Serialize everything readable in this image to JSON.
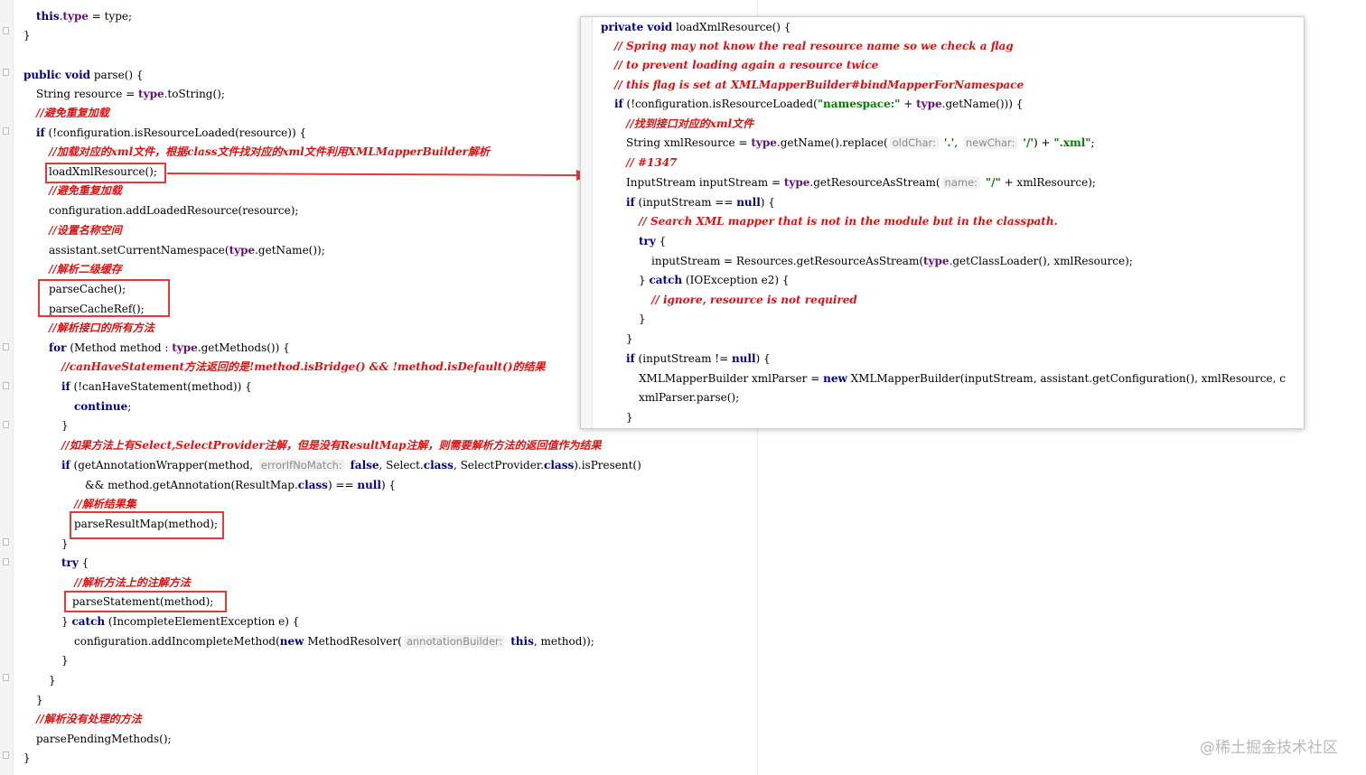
{
  "editor": {
    "lines": [
      [
        {
          "t": "this",
          "c": "kw"
        },
        {
          "t": "."
        },
        {
          "t": "type",
          "c": "fld"
        },
        {
          "t": " = type;"
        }
      ],
      [
        {
          "t": "}"
        }
      ],
      [
        {
          "t": "public void",
          "c": "kw"
        },
        {
          "t": " parse() {"
        }
      ],
      [
        {
          "t": "String resource = "
        },
        {
          "t": "type",
          "c": "fld"
        },
        {
          "t": ".toString();"
        }
      ],
      [
        {
          "t": "//避免重复加载",
          "c": "cm"
        }
      ],
      [
        {
          "t": "if",
          "c": "kw"
        },
        {
          "t": " (!configuration.isResourceLoaded(resource)) {"
        }
      ],
      [
        {
          "t": "//加载对应的xml文件，根据class文件找对应的xml文件利用XMLMapperBuilder解析",
          "c": "cm"
        }
      ],
      [
        {
          "t": "loadXmlResource();"
        }
      ],
      [
        {
          "t": "//避免重复加载",
          "c": "cm"
        }
      ],
      [
        {
          "t": "configuration.addLoadedResource(resource);"
        }
      ],
      [
        {
          "t": "//设置名称空间",
          "c": "cm"
        }
      ],
      [
        {
          "t": "assistant.setCurrentNamespace("
        },
        {
          "t": "type",
          "c": "fld"
        },
        {
          "t": ".getName());"
        }
      ],
      [
        {
          "t": "//解析二级缓存",
          "c": "cm"
        }
      ],
      [
        {
          "t": "parseCache();"
        }
      ],
      [
        {
          "t": "parseCacheRef();"
        }
      ],
      [
        {
          "t": "//解析接口的所有方法",
          "c": "cm"
        }
      ],
      [
        {
          "t": "for",
          "c": "kw"
        },
        {
          "t": " (Method method : "
        },
        {
          "t": "type",
          "c": "fld"
        },
        {
          "t": ".getMethods()) {"
        }
      ],
      [
        {
          "t": "//canHaveStatement方法返回的是!method.isBridge() && !method.isDefault()的结果",
          "c": "cm"
        }
      ],
      [
        {
          "t": "if",
          "c": "kw"
        },
        {
          "t": " (!canHaveStatement(method)) {"
        }
      ],
      [
        {
          "t": "continue",
          "c": "kw"
        },
        {
          "t": ";"
        }
      ],
      [
        {
          "t": "}"
        }
      ],
      [
        {
          "t": "//如果方法上有Select,SelectProvider注解，但是没有ResultMap注解，则需要解析方法的返回值作为结果",
          "c": "cm"
        }
      ],
      [
        {
          "t": "if",
          "c": "kw"
        },
        {
          "t": " (getAnnotationWrapper(method, "
        },
        {
          "t": "errorIfNoMatch:",
          "c": "hint"
        },
        {
          "t": " "
        },
        {
          "t": "false",
          "c": "kw"
        },
        {
          "t": ", Select."
        },
        {
          "t": "class",
          "c": "kw"
        },
        {
          "t": ", SelectProvider."
        },
        {
          "t": "class",
          "c": "kw"
        },
        {
          "t": ").isPresent()"
        }
      ],
      [
        {
          "t": "&& method.getAnnotation(ResultMap."
        },
        {
          "t": "class",
          "c": "kw"
        },
        {
          "t": ") == "
        },
        {
          "t": "null",
          "c": "kw"
        },
        {
          "t": ") {"
        }
      ],
      [
        {
          "t": "//解析结果集",
          "c": "cm"
        }
      ],
      [
        {
          "t": "parseResultMap(method);"
        }
      ],
      [
        {
          "t": "}"
        }
      ],
      [
        {
          "t": "try",
          "c": "kw"
        },
        {
          "t": " {"
        }
      ],
      [
        {
          "t": "//解析方法上的注解方法",
          "c": "cm"
        }
      ],
      [
        {
          "t": "parseStatement(method);"
        }
      ],
      [
        {
          "t": "} "
        },
        {
          "t": "catch",
          "c": "kw"
        },
        {
          "t": " (IncompleteElementException e) {"
        }
      ],
      [
        {
          "t": "configuration.addIncompleteMethod("
        },
        {
          "t": "new",
          "c": "kw"
        },
        {
          "t": " MethodResolver("
        },
        {
          "t": "annotationBuilder:",
          "c": "hint"
        },
        {
          "t": " "
        },
        {
          "t": "this",
          "c": "kw"
        },
        {
          "t": ", method));"
        }
      ],
      [
        {
          "t": "}"
        }
      ],
      [
        {
          "t": "}"
        }
      ],
      [
        {
          "t": "}"
        }
      ],
      [
        {
          "t": "//解析没有处理的方法",
          "c": "cm"
        }
      ],
      [
        {
          "t": "parsePendingMethods();"
        }
      ],
      [
        {
          "t": "}"
        }
      ]
    ]
  },
  "popup": {
    "lines": [
      [
        {
          "t": "private void",
          "c": "kw"
        },
        {
          "t": " loadXmlResource() {"
        }
      ],
      [
        {
          "t": "// Spring may not know the real resource name so we check a flag",
          "c": "cm"
        }
      ],
      [
        {
          "t": "// to prevent loading again a resource twice",
          "c": "cm"
        }
      ],
      [
        {
          "t": "// this flag is set at XMLMapperBuilder#bindMapperForNamespace",
          "c": "cm"
        }
      ],
      [
        {
          "t": "if",
          "c": "kw"
        },
        {
          "t": " (!configuration.isResourceLoaded("
        },
        {
          "t": "\"namespace:\"",
          "c": "str"
        },
        {
          "t": " + "
        },
        {
          "t": "type",
          "c": "fld"
        },
        {
          "t": ".getName())) {"
        }
      ],
      [
        {
          "t": "//找到接口对应的xml文件",
          "c": "cm"
        }
      ],
      [
        {
          "t": "String xmlResource = "
        },
        {
          "t": "type",
          "c": "fld"
        },
        {
          "t": ".getName().replace("
        },
        {
          "t": "oldChar:",
          "c": "hint"
        },
        {
          "t": " "
        },
        {
          "t": "'.'",
          "c": "str"
        },
        {
          "t": ", "
        },
        {
          "t": "newChar:",
          "c": "hint"
        },
        {
          "t": " "
        },
        {
          "t": "'/'",
          "c": "str"
        },
        {
          "t": ") + "
        },
        {
          "t": "\".xml\"",
          "c": "str"
        },
        {
          "t": ";"
        }
      ],
      [
        {
          "t": "// #1347",
          "c": "cm"
        }
      ],
      [
        {
          "t": "InputStream inputStream = "
        },
        {
          "t": "type",
          "c": "fld"
        },
        {
          "t": ".getResourceAsStream("
        },
        {
          "t": "name:",
          "c": "hint"
        },
        {
          "t": " "
        },
        {
          "t": "\"/\"",
          "c": "str"
        },
        {
          "t": " + xmlResource);"
        }
      ],
      [
        {
          "t": "if",
          "c": "kw"
        },
        {
          "t": " (inputStream == "
        },
        {
          "t": "null",
          "c": "kw"
        },
        {
          "t": ") {"
        }
      ],
      [
        {
          "t": "// Search XML mapper that is not in the module but in the classpath.",
          "c": "cm"
        }
      ],
      [
        {
          "t": "try",
          "c": "kw"
        },
        {
          "t": " {"
        }
      ],
      [
        {
          "t": "inputStream = Resources.getResourceAsStream("
        },
        {
          "t": "type",
          "c": "fld"
        },
        {
          "t": ".getClassLoader(), xmlResource);"
        }
      ],
      [
        {
          "t": "} "
        },
        {
          "t": "catch",
          "c": "kw"
        },
        {
          "t": " (IOException e2) {"
        }
      ],
      [
        {
          "t": "// ignore, resource is not required",
          "c": "cm"
        }
      ],
      [
        {
          "t": "}"
        }
      ],
      [
        {
          "t": "}"
        }
      ],
      [
        {
          "t": "if",
          "c": "kw"
        },
        {
          "t": " (inputStream != "
        },
        {
          "t": "null",
          "c": "kw"
        },
        {
          "t": ") {"
        }
      ],
      [
        {
          "t": "XMLMapperBuilder xmlParser = "
        },
        {
          "t": "new",
          "c": "kw"
        },
        {
          "t": " XMLMapperBuilder(inputStream, assistant.getConfiguration(), xmlResource, c"
        }
      ],
      [
        {
          "t": "xmlParser.parse();"
        }
      ],
      [
        {
          "t": "}"
        }
      ]
    ]
  },
  "watermark": "@稀土掘金技术社区",
  "colors": {
    "keyword": "#000080",
    "field": "#660e7a",
    "comment": "#e01010",
    "string": "#008000",
    "highlight": "#e53935",
    "arrow": "#e53935"
  }
}
